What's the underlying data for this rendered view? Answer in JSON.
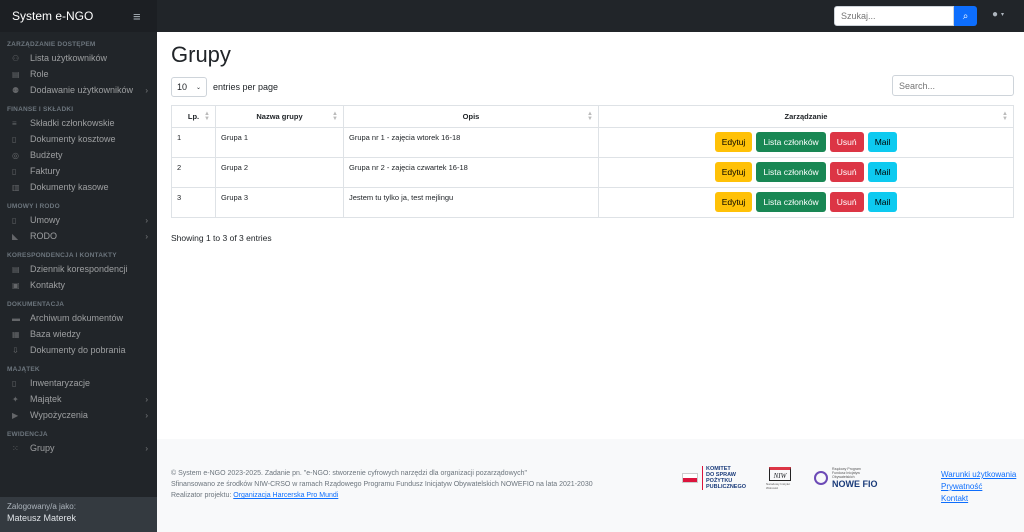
{
  "app": {
    "title": "System e-NGO"
  },
  "topbar": {
    "search_placeholder": "Szukaj..."
  },
  "sidebar": {
    "sections": [
      {
        "title": "Zarządzanie dostępem",
        "items": [
          {
            "label": "Lista użytkowników",
            "icon": "users-icon",
            "arrow": false
          },
          {
            "label": "Role",
            "icon": "id-card-icon",
            "arrow": false
          },
          {
            "label": "Dodawanie użytkowników",
            "icon": "user-plus-icon",
            "arrow": true
          }
        ]
      },
      {
        "title": "Finanse i składki",
        "items": [
          {
            "label": "Składki członkowskie",
            "icon": "coins-icon",
            "arrow": false
          },
          {
            "label": "Dokumenty kosztowe",
            "icon": "document-icon",
            "arrow": false
          },
          {
            "label": "Budżety",
            "icon": "budget-icon",
            "arrow": false
          },
          {
            "label": "Faktury",
            "icon": "invoice-icon",
            "arrow": false
          },
          {
            "label": "Dokumenty kasowe",
            "icon": "cash-icon",
            "arrow": false
          }
        ]
      },
      {
        "title": "Umowy i RODO",
        "items": [
          {
            "label": "Umowy",
            "icon": "contract-icon",
            "arrow": true
          },
          {
            "label": "RODO",
            "icon": "shield-icon",
            "arrow": true
          }
        ]
      },
      {
        "title": "Korespondencja i kontakty",
        "items": [
          {
            "label": "Dziennik korespondencji",
            "icon": "journal-icon",
            "arrow": false
          },
          {
            "label": "Kontakty",
            "icon": "address-book-icon",
            "arrow": false
          }
        ]
      },
      {
        "title": "Dokumentacja",
        "items": [
          {
            "label": "Archiwum dokumentów",
            "icon": "archive-icon",
            "arrow": false
          },
          {
            "label": "Baza wiedzy",
            "icon": "book-icon",
            "arrow": false
          },
          {
            "label": "Dokumenty do pobrania",
            "icon": "download-icon",
            "arrow": false
          }
        ]
      },
      {
        "title": "Majątek",
        "items": [
          {
            "label": "Inwentaryzacje",
            "icon": "clipboard-icon",
            "arrow": false
          },
          {
            "label": "Majątek",
            "icon": "tools-icon",
            "arrow": true
          },
          {
            "label": "Wypożyczenia",
            "icon": "truck-icon",
            "arrow": true
          }
        ]
      },
      {
        "title": "Ewidencja",
        "items": [
          {
            "label": "Grupy",
            "icon": "groups-icon",
            "arrow": true
          }
        ]
      }
    ],
    "logged_in_label": "Zalogowany/a jako:",
    "user_name": "Mateusz Materek"
  },
  "main": {
    "title": "Grupy",
    "length_value": "10",
    "length_label": "entries per page",
    "search_placeholder": "Search...",
    "columns": [
      "Lp.",
      "Nazwa grupy",
      "Opis",
      "Zarządzanie"
    ],
    "rows": [
      {
        "lp": "1",
        "name": "Grupa 1",
        "desc": "Grupa nr 1 - zajęcia wtorek 16-18"
      },
      {
        "lp": "2",
        "name": "Grupa 2",
        "desc": "Grupa nr 2 - zajęcia czwartek 16-18"
      },
      {
        "lp": "3",
        "name": "Grupa 3",
        "desc": "Jestem tu tylko ja, test mejlingu"
      }
    ],
    "actions": {
      "edit": "Edytuj",
      "members": "Lista członków",
      "delete": "Usuń",
      "mail": "Mail"
    },
    "info": "Showing 1 to 3 of 3 entries"
  },
  "footer": {
    "line1": "© System e-NGO 2023-2025. Zadanie pn. \"e-NGO: stworzenie cyfrowych narzędzi dla organizacji pozarządowych\"",
    "line2": "Sfinansowano ze środków NIW-CRSO w ramach Rządowego Programu Fundusz Inicjatyw Obywatelskich NOWEFIO na lata 2021-2030",
    "line3_prefix": "Realizator projektu:",
    "line3_link": "Organizacja Harcerska Pro Mundi",
    "logo1_lines": [
      "KOMITET",
      "DO SPRAW",
      "POŻYTKU",
      "PUBLICZNEGO"
    ],
    "logo2_text": "NIW",
    "logo2_sub": "Narodowy Instytut Wolności",
    "logo3_small": [
      "Rządowy Program",
      "Fundusz Inicjatyw",
      "Obywatelskich"
    ],
    "logo3_big": "NOWE FIO",
    "links": [
      "Warunki użytkowania",
      "Prywatność",
      "Kontakt"
    ]
  }
}
